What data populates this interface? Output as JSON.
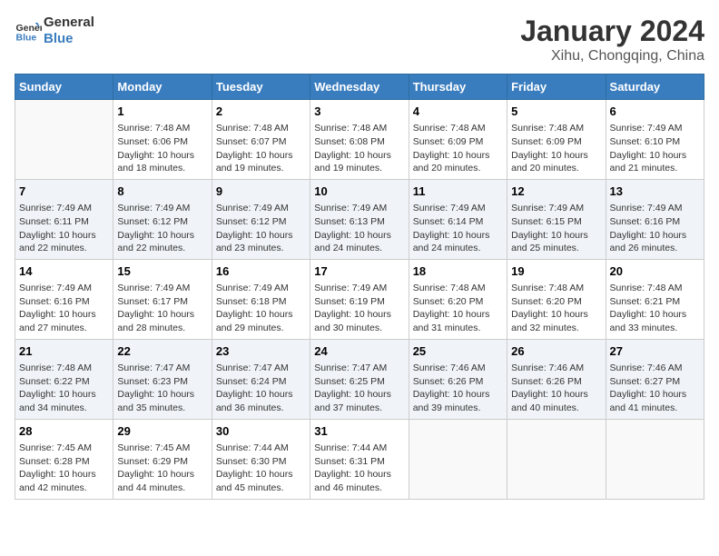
{
  "logo": {
    "text_general": "General",
    "text_blue": "Blue"
  },
  "title": "January 2024",
  "subtitle": "Xihu, Chongqing, China",
  "days_of_week": [
    "Sunday",
    "Monday",
    "Tuesday",
    "Wednesday",
    "Thursday",
    "Friday",
    "Saturday"
  ],
  "weeks": [
    [
      {
        "day": "",
        "info": ""
      },
      {
        "day": "1",
        "info": "Sunrise: 7:48 AM\nSunset: 6:06 PM\nDaylight: 10 hours\nand 18 minutes."
      },
      {
        "day": "2",
        "info": "Sunrise: 7:48 AM\nSunset: 6:07 PM\nDaylight: 10 hours\nand 19 minutes."
      },
      {
        "day": "3",
        "info": "Sunrise: 7:48 AM\nSunset: 6:08 PM\nDaylight: 10 hours\nand 19 minutes."
      },
      {
        "day": "4",
        "info": "Sunrise: 7:48 AM\nSunset: 6:09 PM\nDaylight: 10 hours\nand 20 minutes."
      },
      {
        "day": "5",
        "info": "Sunrise: 7:48 AM\nSunset: 6:09 PM\nDaylight: 10 hours\nand 20 minutes."
      },
      {
        "day": "6",
        "info": "Sunrise: 7:49 AM\nSunset: 6:10 PM\nDaylight: 10 hours\nand 21 minutes."
      }
    ],
    [
      {
        "day": "7",
        "info": "Sunrise: 7:49 AM\nSunset: 6:11 PM\nDaylight: 10 hours\nand 22 minutes."
      },
      {
        "day": "8",
        "info": "Sunrise: 7:49 AM\nSunset: 6:12 PM\nDaylight: 10 hours\nand 22 minutes."
      },
      {
        "day": "9",
        "info": "Sunrise: 7:49 AM\nSunset: 6:12 PM\nDaylight: 10 hours\nand 23 minutes."
      },
      {
        "day": "10",
        "info": "Sunrise: 7:49 AM\nSunset: 6:13 PM\nDaylight: 10 hours\nand 24 minutes."
      },
      {
        "day": "11",
        "info": "Sunrise: 7:49 AM\nSunset: 6:14 PM\nDaylight: 10 hours\nand 24 minutes."
      },
      {
        "day": "12",
        "info": "Sunrise: 7:49 AM\nSunset: 6:15 PM\nDaylight: 10 hours\nand 25 minutes."
      },
      {
        "day": "13",
        "info": "Sunrise: 7:49 AM\nSunset: 6:16 PM\nDaylight: 10 hours\nand 26 minutes."
      }
    ],
    [
      {
        "day": "14",
        "info": "Sunrise: 7:49 AM\nSunset: 6:16 PM\nDaylight: 10 hours\nand 27 minutes."
      },
      {
        "day": "15",
        "info": "Sunrise: 7:49 AM\nSunset: 6:17 PM\nDaylight: 10 hours\nand 28 minutes."
      },
      {
        "day": "16",
        "info": "Sunrise: 7:49 AM\nSunset: 6:18 PM\nDaylight: 10 hours\nand 29 minutes."
      },
      {
        "day": "17",
        "info": "Sunrise: 7:49 AM\nSunset: 6:19 PM\nDaylight: 10 hours\nand 30 minutes."
      },
      {
        "day": "18",
        "info": "Sunrise: 7:48 AM\nSunset: 6:20 PM\nDaylight: 10 hours\nand 31 minutes."
      },
      {
        "day": "19",
        "info": "Sunrise: 7:48 AM\nSunset: 6:20 PM\nDaylight: 10 hours\nand 32 minutes."
      },
      {
        "day": "20",
        "info": "Sunrise: 7:48 AM\nSunset: 6:21 PM\nDaylight: 10 hours\nand 33 minutes."
      }
    ],
    [
      {
        "day": "21",
        "info": "Sunrise: 7:48 AM\nSunset: 6:22 PM\nDaylight: 10 hours\nand 34 minutes."
      },
      {
        "day": "22",
        "info": "Sunrise: 7:47 AM\nSunset: 6:23 PM\nDaylight: 10 hours\nand 35 minutes."
      },
      {
        "day": "23",
        "info": "Sunrise: 7:47 AM\nSunset: 6:24 PM\nDaylight: 10 hours\nand 36 minutes."
      },
      {
        "day": "24",
        "info": "Sunrise: 7:47 AM\nSunset: 6:25 PM\nDaylight: 10 hours\nand 37 minutes."
      },
      {
        "day": "25",
        "info": "Sunrise: 7:46 AM\nSunset: 6:26 PM\nDaylight: 10 hours\nand 39 minutes."
      },
      {
        "day": "26",
        "info": "Sunrise: 7:46 AM\nSunset: 6:26 PM\nDaylight: 10 hours\nand 40 minutes."
      },
      {
        "day": "27",
        "info": "Sunrise: 7:46 AM\nSunset: 6:27 PM\nDaylight: 10 hours\nand 41 minutes."
      }
    ],
    [
      {
        "day": "28",
        "info": "Sunrise: 7:45 AM\nSunset: 6:28 PM\nDaylight: 10 hours\nand 42 minutes."
      },
      {
        "day": "29",
        "info": "Sunrise: 7:45 AM\nSunset: 6:29 PM\nDaylight: 10 hours\nand 44 minutes."
      },
      {
        "day": "30",
        "info": "Sunrise: 7:44 AM\nSunset: 6:30 PM\nDaylight: 10 hours\nand 45 minutes."
      },
      {
        "day": "31",
        "info": "Sunrise: 7:44 AM\nSunset: 6:31 PM\nDaylight: 10 hours\nand 46 minutes."
      },
      {
        "day": "",
        "info": ""
      },
      {
        "day": "",
        "info": ""
      },
      {
        "day": "",
        "info": ""
      }
    ]
  ]
}
